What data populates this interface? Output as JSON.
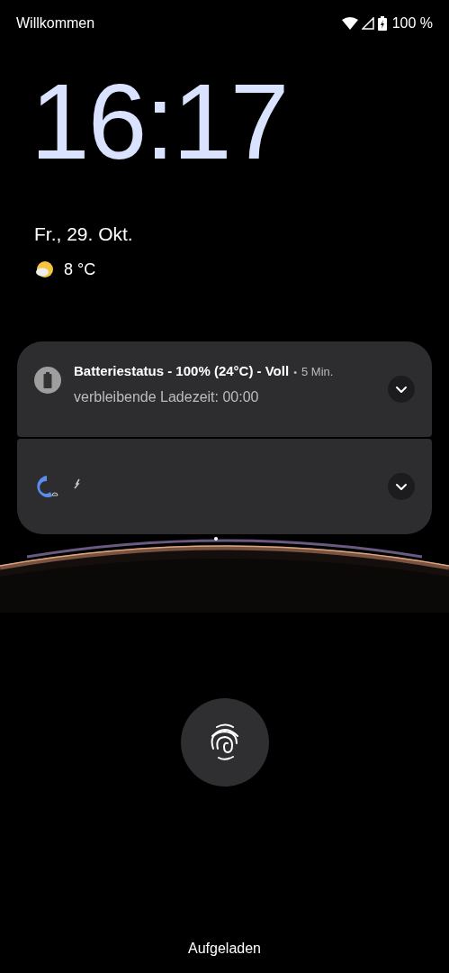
{
  "status_bar": {
    "carrier": "Willkommen",
    "battery": "100 %"
  },
  "clock": {
    "time": "16:17",
    "date": "Fr., 29. Okt.",
    "temperature": "8 °C"
  },
  "notifications": [
    {
      "kind": "battery",
      "title": "Batteriestatus - 100% (24°C) - Voll",
      "separator": "•",
      "time": "5 Min.",
      "text": "verbleibende Ladezeit: 00:00",
      "expanded": false
    },
    {
      "kind": "app",
      "expanded": false
    }
  ],
  "bottom": {
    "status": "Aufgeladen"
  }
}
